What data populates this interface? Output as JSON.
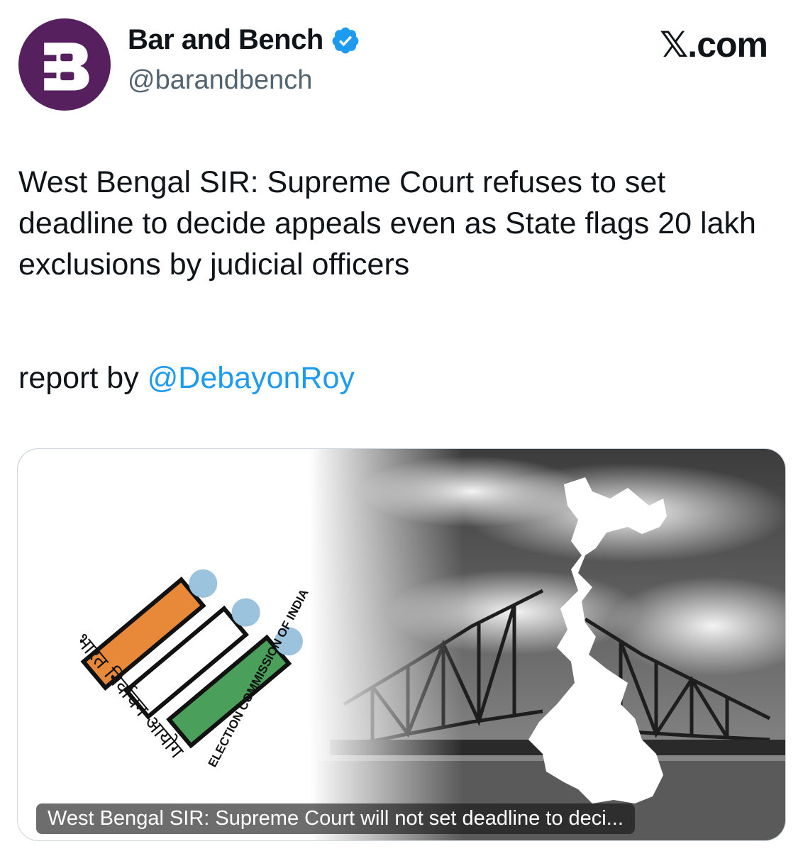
{
  "author": {
    "display_name": "Bar and Bench",
    "handle": "@barandbench",
    "avatar_icon": "bar-and-bench-logo",
    "avatar_color": "#56205f",
    "verified": true,
    "verified_icon": "verified-badge-icon",
    "verified_color": "#1d9bf0"
  },
  "brand": {
    "label": "𝕏.com"
  },
  "tweet": {
    "text": "West Bengal SIR: Supreme Court refuses to set deadline to decide appeals even as State flags 20 lakh exclusions by judicial officers",
    "byline_prefix": "report by ",
    "mention": "@DebayonRoy",
    "mention_color": "#1d9bf0"
  },
  "link_card": {
    "caption": "West Bengal SIR: Supreme Court will not set deadline to deci...",
    "image": {
      "logo_text_english": "ELECTION COMMISSION OF INDIA",
      "logo_text_hindi": "भारत निर्वाचन आयोग",
      "bar_colors": [
        "#e8893a",
        "#ffffff",
        "#4aa05a"
      ],
      "dot_color": "#9cc3dd"
    }
  }
}
